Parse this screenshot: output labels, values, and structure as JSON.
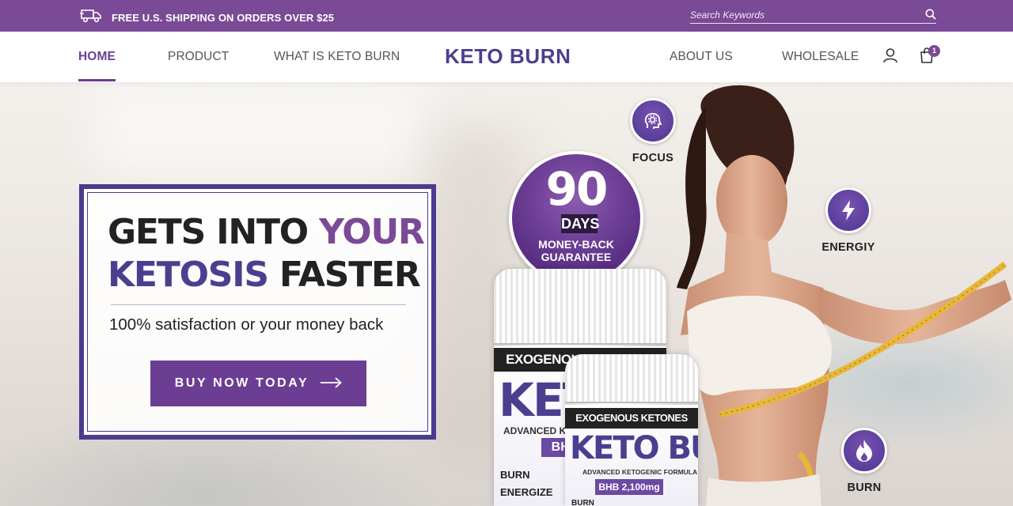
{
  "topbar": {
    "shipping_text": "FREE U.S. SHIPPING ON ORDERS OVER $25",
    "search_placeholder": "Search Keywords",
    "icons": [
      "truck-icon",
      "search-icon"
    ]
  },
  "header": {
    "nav_left": [
      {
        "label": "HOME",
        "active": true
      },
      {
        "label": "PRODUCT",
        "active": false
      },
      {
        "label": "WHAT IS KETO BURN",
        "active": false
      }
    ],
    "logo": "KETO BURN",
    "nav_right": [
      {
        "label": "ABOUT US"
      },
      {
        "label": "WHOLESALE"
      }
    ],
    "cart_count": "1",
    "icons": [
      "user-icon",
      "cart-icon"
    ]
  },
  "hero": {
    "headline_line1_a": "GETS INTO ",
    "headline_line1_b": "YOUR",
    "headline_line2_a": "KETOSIS",
    "headline_line2_b": " FASTER",
    "subheadline": "100% satisfaction or your money back",
    "cta_label": "BUY NOW TODAY",
    "guarantee": {
      "number": "90",
      "unit": "DAYS",
      "line1": "MONEY-BACK",
      "line2": "GUARANTEE"
    },
    "bottle_back": {
      "top_label": "EXOGENOUS KETONES",
      "brand": "KETO B",
      "formula": "ADVANCED K",
      "bhb": "BHB",
      "features": [
        "BURN",
        "ENERGIZE"
      ]
    },
    "bottle_front": {
      "top_label": "EXOGENOUS KETONES",
      "brand": "KETO BURN",
      "formula": "ADVANCED KETOGENIC FORMULA",
      "bhb": "BHB 2,100mg",
      "features": [
        "BURN"
      ]
    },
    "benefits": [
      {
        "label": "FOCUS",
        "icon": "brain-gear-icon"
      },
      {
        "label": "ENERGIY",
        "icon": "lightning-icon"
      },
      {
        "label": "BURN",
        "icon": "flame-icon"
      }
    ]
  },
  "colors": {
    "topbar_bg": "#7a4a96",
    "accent_purple": "#6b3e93",
    "logo_indigo": "#4a3f8f"
  }
}
